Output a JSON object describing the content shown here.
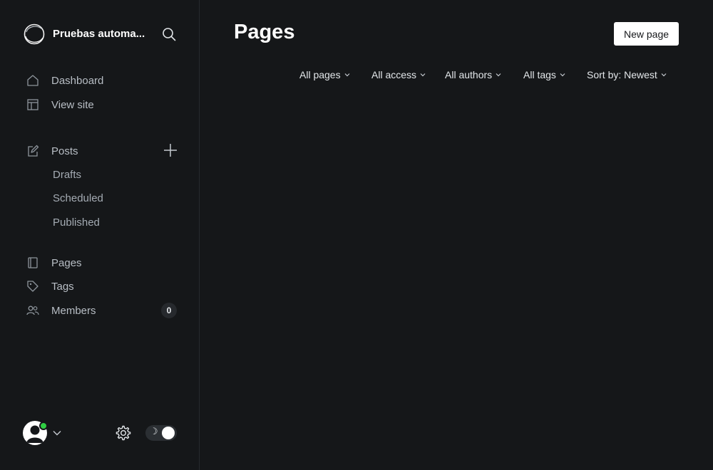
{
  "sidebar": {
    "site_title": "Pruebas automa...",
    "nav_primary": [
      {
        "label": "Dashboard",
        "icon": "home-icon"
      },
      {
        "label": "View site",
        "icon": "layout-icon"
      }
    ],
    "posts": {
      "label": "Posts",
      "icon": "pencil-edit-icon",
      "sub_items": [
        "Drafts",
        "Scheduled",
        "Published"
      ]
    },
    "nav_secondary": [
      {
        "label": "Pages",
        "icon": "page-icon"
      },
      {
        "label": "Tags",
        "icon": "tag-icon"
      },
      {
        "label": "Members",
        "icon": "members-icon",
        "count": "0"
      }
    ],
    "footer": {
      "user_status_color": "#30cf43",
      "theme": "dark"
    }
  },
  "main": {
    "title": "Pages",
    "new_button_label": "New page",
    "filters": [
      {
        "label": "All pages"
      },
      {
        "label": "All access"
      },
      {
        "label": "All authors"
      },
      {
        "label": "All tags"
      },
      {
        "label": "Sort by: Newest"
      }
    ]
  },
  "colors": {
    "background": "#151719",
    "text": "#ffffff",
    "accent_online": "#30cf43",
    "primary_button_bg": "#ffffff"
  }
}
